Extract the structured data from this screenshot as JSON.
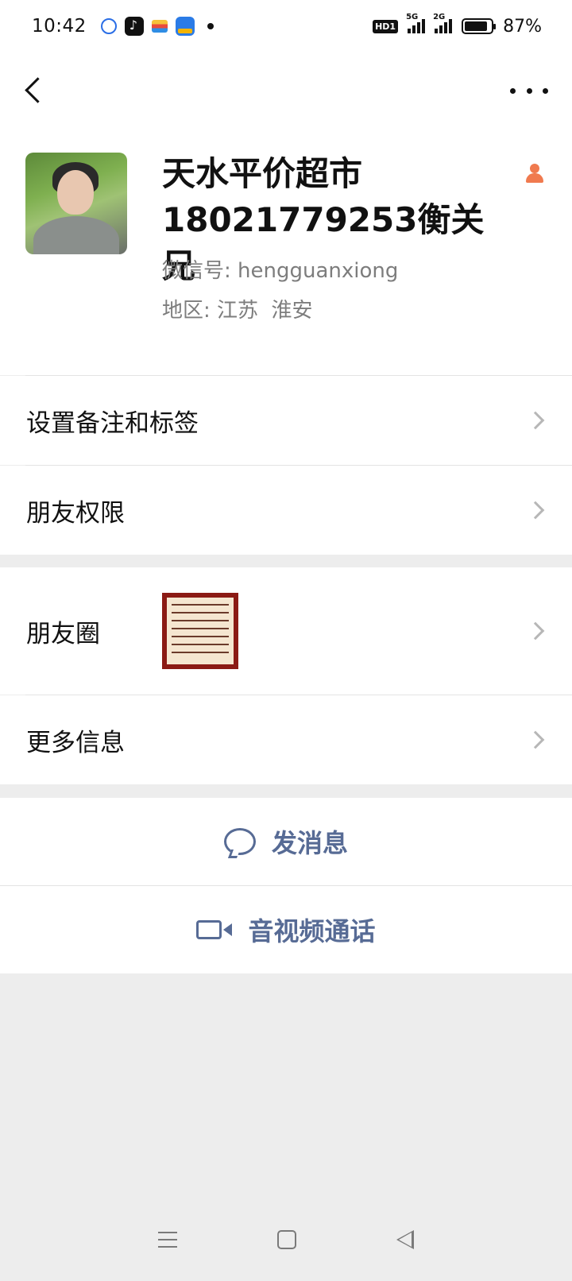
{
  "status_bar": {
    "time": "10:42",
    "network_5g": "5G",
    "network_2g": "2G",
    "hd_label": "HD1",
    "battery_percent": "87%",
    "battery_level": 0.87
  },
  "profile": {
    "name": "天水平价超市18021779253衡关兄",
    "wechat_id_label": "微信号:",
    "wechat_id": "hengguanxiong",
    "region_label": "地区:",
    "region": "江苏  淮安"
  },
  "menu": {
    "remark_tags": "设置备注和标签",
    "friend_permissions": "朋友权限",
    "moments": "朋友圈",
    "more_info": "更多信息"
  },
  "actions": {
    "send_message": "发消息",
    "av_call": "音视频通话"
  },
  "colors": {
    "link_blue": "#576b95",
    "gender_icon": "#f07a4f",
    "background": "#ededed"
  }
}
